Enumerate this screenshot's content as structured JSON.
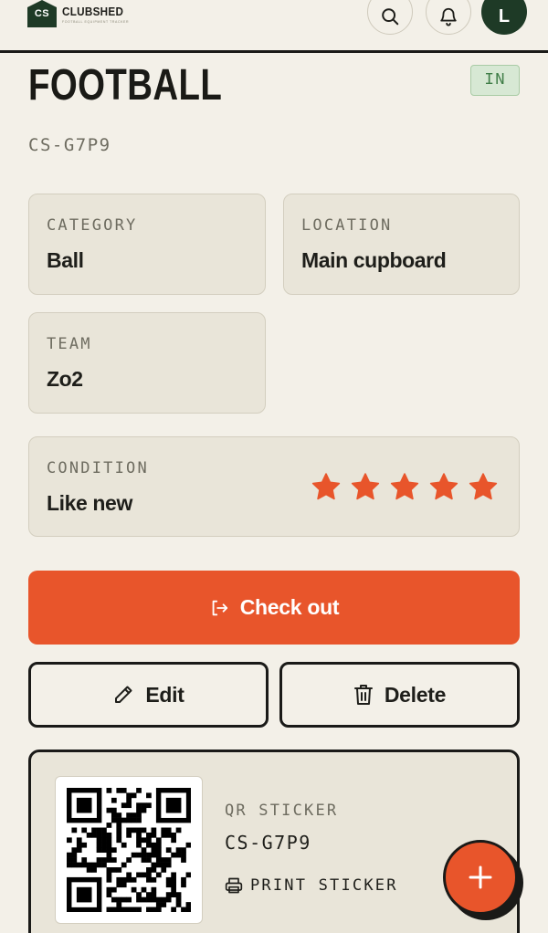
{
  "app": {
    "logo_mark": "CS",
    "name": "CLUBSHED",
    "tagline": "FOOTBALL EQUIPMENT TRACKER",
    "user_initial": "L",
    "icons": {
      "search": "search-icon",
      "notifications": "bell-icon"
    }
  },
  "item": {
    "name": "FOOTBALL",
    "status": "IN",
    "code": "CS-G7P9"
  },
  "details": {
    "category": {
      "label": "CATEGORY",
      "value": "Ball"
    },
    "location": {
      "label": "LOCATION",
      "value": "Main cupboard"
    },
    "team": {
      "label": "TEAM",
      "value": "Zo2"
    },
    "condition": {
      "label": "CONDITION",
      "value": "Like new",
      "rating": 5,
      "max_rating": 5
    }
  },
  "actions": {
    "checkout_label": "Check out",
    "edit_label": "Edit",
    "delete_label": "Delete"
  },
  "qr": {
    "label": "QR STICKER",
    "code": "CS-G7P9",
    "print_label": "PRINT STICKER"
  },
  "colors": {
    "accent": "#e8552b",
    "background": "#f3f0e8",
    "card": "#e9e5d9",
    "status_in": "#3f7d47",
    "avatar": "#1e3a26"
  }
}
